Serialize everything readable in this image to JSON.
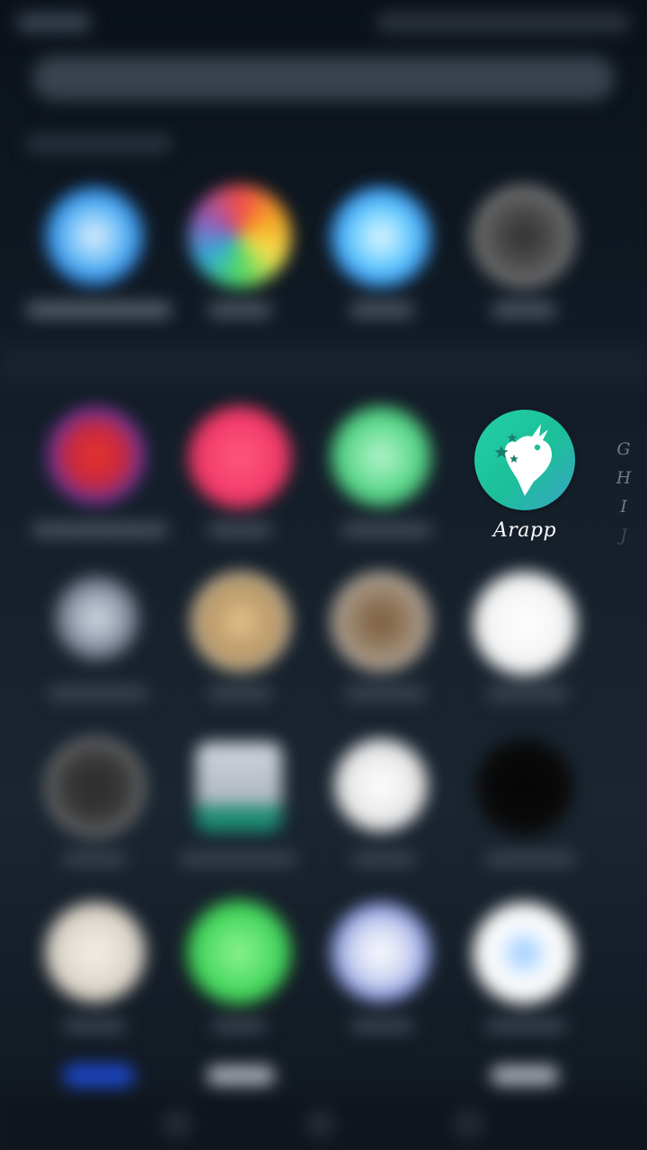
{
  "highlighted_app": {
    "label": "Arapp",
    "icon": "arapp-map-pin-dino-icon",
    "colors": {
      "gradient_start": "#22d0a6",
      "gradient_end": "#3aa4c6",
      "glyph": "#ffffff"
    }
  },
  "alphabet_index": {
    "letters": [
      "G",
      "H",
      "I",
      "J"
    ]
  },
  "theme": {
    "background": "#141e29",
    "overlay_dimmed": true
  }
}
